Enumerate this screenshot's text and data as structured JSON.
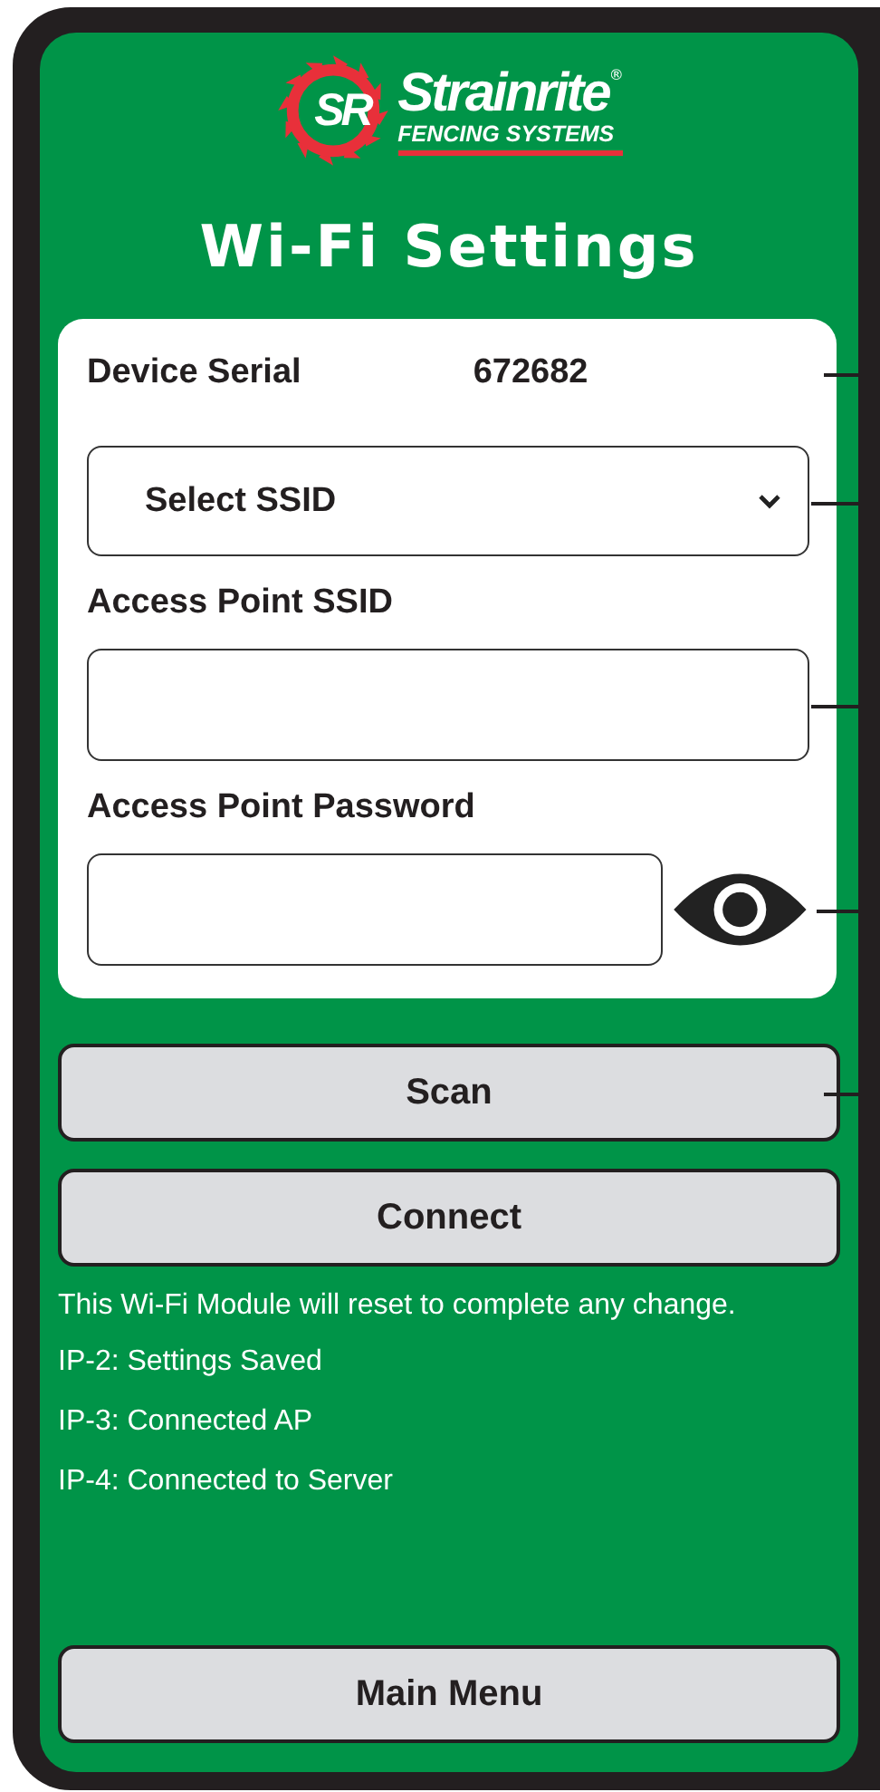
{
  "logo": {
    "mark": "SR",
    "brand": "Strainrite",
    "registered": "®",
    "tagline": "FENCING SYSTEMS"
  },
  "title": "Wi-Fi Settings",
  "serial": {
    "label": "Device Serial",
    "value": "672682"
  },
  "ssid_select": {
    "value": "Select SSID"
  },
  "fields": [
    {
      "label": "Access Point SSID",
      "kind": "text"
    },
    {
      "label": "Access Point Password",
      "kind": "password"
    }
  ],
  "buttons": [
    "Scan",
    "Connect"
  ],
  "notice": "This Wi-Fi Module will reset to complete any change.",
  "status_lines": [
    "IP-2: Settings Saved",
    "IP-3: Connected AP",
    "IP-4: Connected to Server"
  ],
  "footer_button": "Main Menu"
}
